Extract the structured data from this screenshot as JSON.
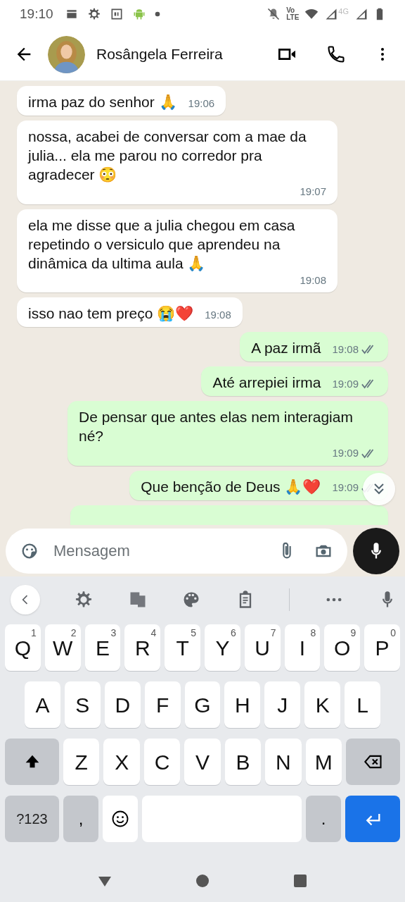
{
  "status_bar": {
    "time": "19:10",
    "network_label_top": "Vo",
    "network_label_bottom": "LTE",
    "data_label": "4G"
  },
  "header": {
    "contact_name": "Rosângela Ferreira"
  },
  "messages": [
    {
      "outgoing": false,
      "text": "irma paz do senhor 🙏",
      "time": "19:06"
    },
    {
      "outgoing": false,
      "text": "nossa, acabei de conversar com a mae da julia... ela me parou no corredor pra agradecer 😳",
      "time": "19:07"
    },
    {
      "outgoing": false,
      "text": "ela me disse que a julia chegou em casa repetindo o versiculo que aprendeu na dinâmica da ultima aula 🙏",
      "time": "19:08"
    },
    {
      "outgoing": false,
      "text": "isso nao tem preço 😭❤️",
      "time": "19:08"
    },
    {
      "outgoing": true,
      "text": "A paz irmã",
      "time": "19:08",
      "read": false
    },
    {
      "outgoing": true,
      "text": "Até arrepiei irma",
      "time": "19:09",
      "read": false
    },
    {
      "outgoing": true,
      "text": "De pensar que antes elas nem interagiam né?",
      "time": "19:09",
      "read": false
    },
    {
      "outgoing": true,
      "text": "Que benção de Deus 🙏❤️",
      "time": "19:09",
      "read": false
    },
    {
      "outgoing": true
    }
  ],
  "composer": {
    "placeholder": "Mensagem"
  },
  "keyboard": {
    "rows": [
      [
        {
          "key": "Q",
          "hint": "1"
        },
        {
          "key": "W",
          "hint": "2"
        },
        {
          "key": "E",
          "hint": "3"
        },
        {
          "key": "R",
          "hint": "4"
        },
        {
          "key": "T",
          "hint": "5"
        },
        {
          "key": "Y",
          "hint": "6"
        },
        {
          "key": "U",
          "hint": "7"
        },
        {
          "key": "I",
          "hint": "8"
        },
        {
          "key": "O",
          "hint": "9"
        },
        {
          "key": "P",
          "hint": "0"
        }
      ],
      [
        {
          "key": "A"
        },
        {
          "key": "S"
        },
        {
          "key": "D"
        },
        {
          "key": "F"
        },
        {
          "key": "G"
        },
        {
          "key": "H"
        },
        {
          "key": "J"
        },
        {
          "key": "K"
        },
        {
          "key": "L"
        }
      ],
      [
        {
          "key": "Z"
        },
        {
          "key": "X"
        },
        {
          "key": "C"
        },
        {
          "key": "V"
        },
        {
          "key": "B"
        },
        {
          "key": "N"
        },
        {
          "key": "M"
        }
      ]
    ],
    "symbols_key": "?123",
    "comma_key": ",",
    "period_key": "."
  }
}
